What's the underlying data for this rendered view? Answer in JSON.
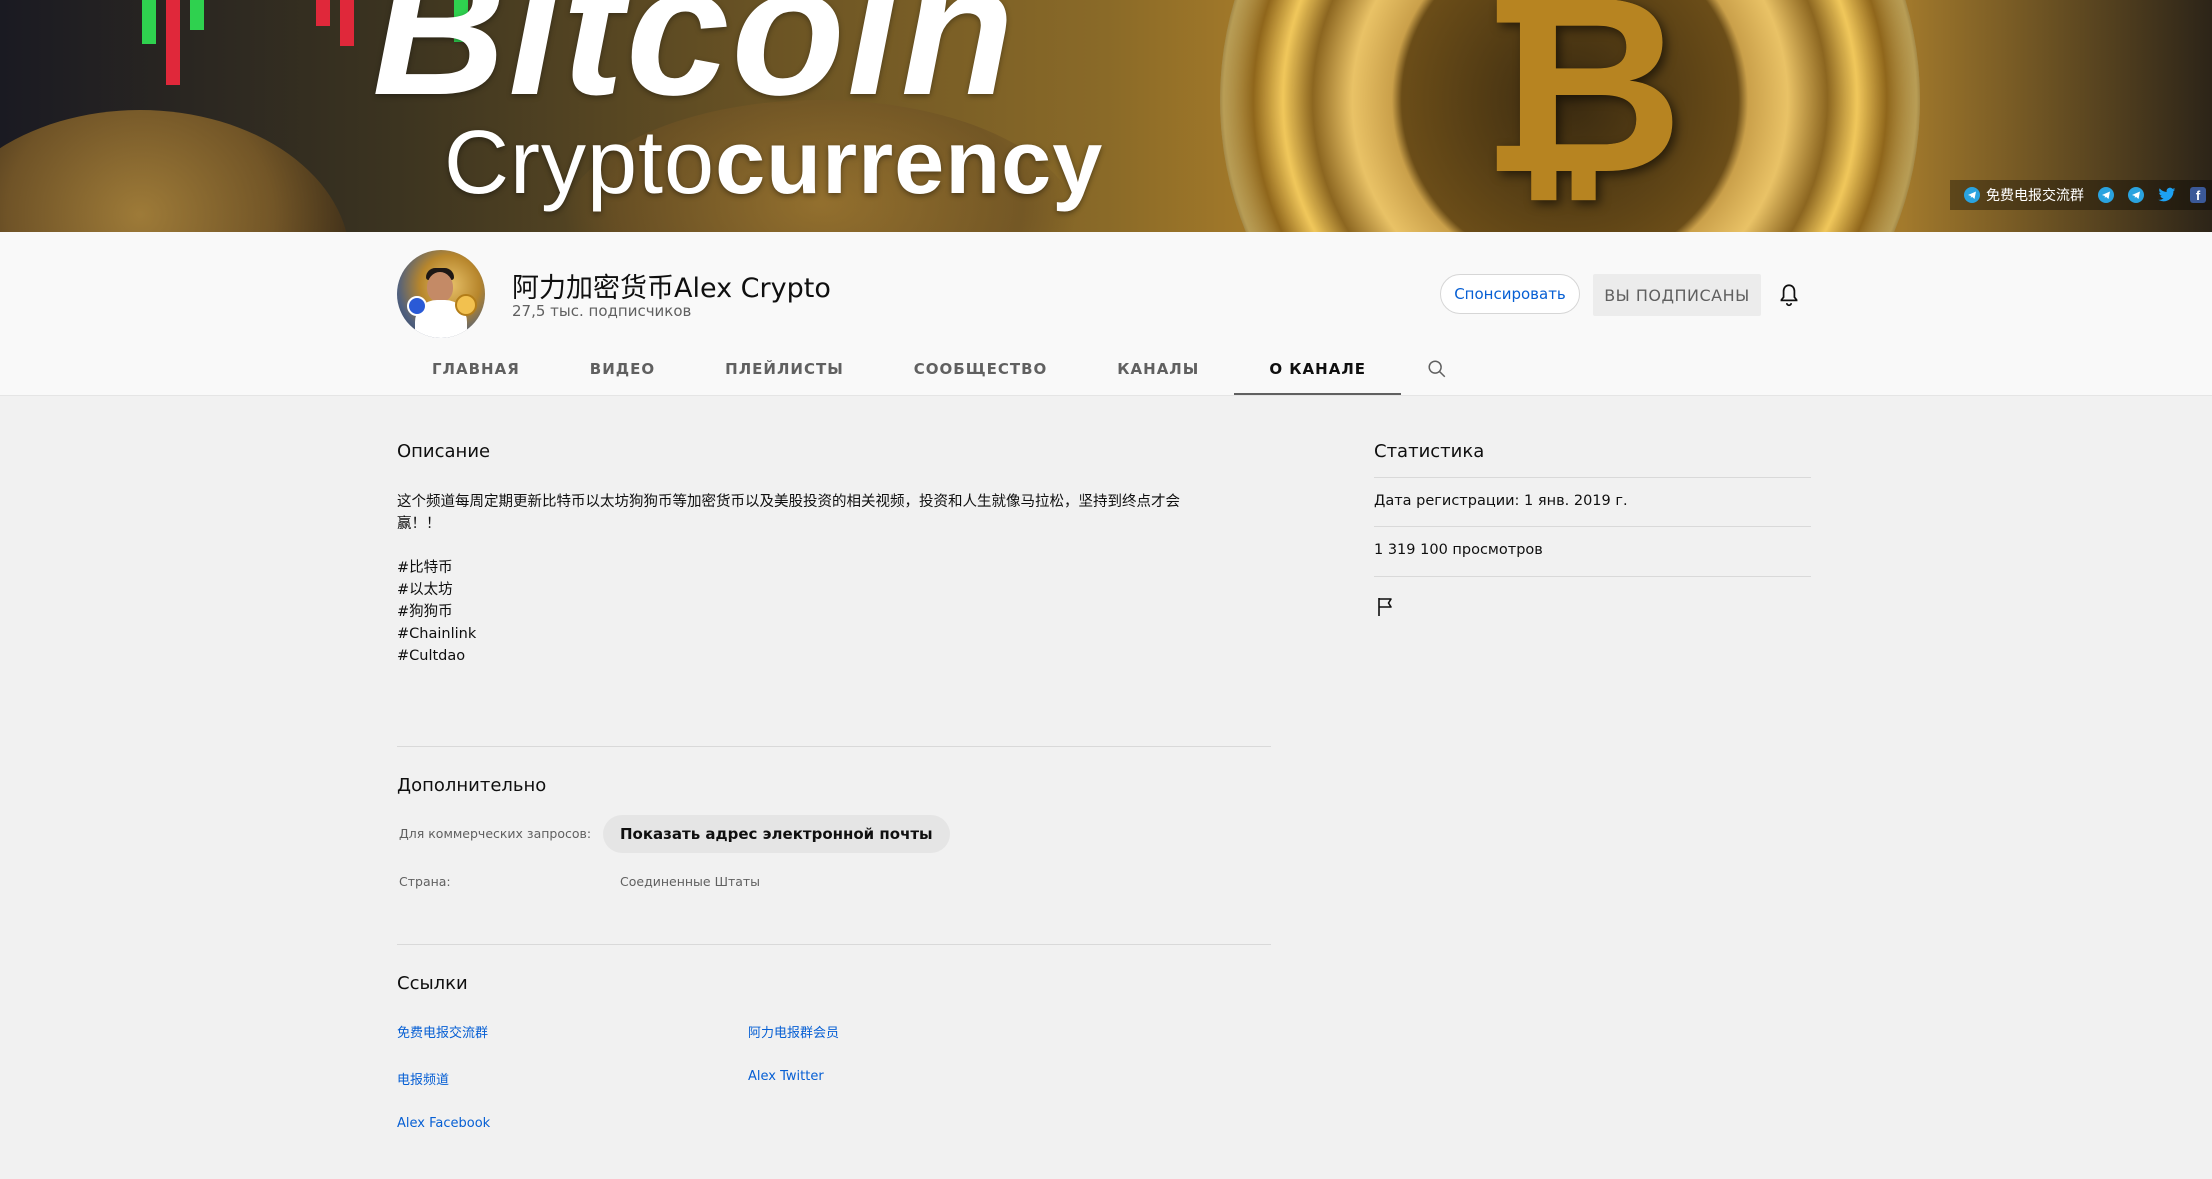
{
  "banner": {
    "title": "Bitcoin",
    "subtitle_light": "Crypto",
    "subtitle_bold": "currency",
    "links": [
      {
        "label": "免费电报交流群",
        "icon": "telegram-icon"
      },
      {
        "label": "",
        "icon": "telegram-icon"
      },
      {
        "label": "",
        "icon": "telegram-icon"
      },
      {
        "label": "",
        "icon": "twitter-icon"
      },
      {
        "label": "",
        "icon": "facebook-icon"
      }
    ]
  },
  "channel": {
    "name": "阿力加密货币Alex Crypto",
    "subscribers": "27,5 тыс. подписчиков",
    "sponsor_label": "Спонсировать",
    "subscribed_label": "ВЫ ПОДПИСАНЫ"
  },
  "tabs": [
    {
      "label": "ГЛАВНАЯ"
    },
    {
      "label": "ВИДЕО"
    },
    {
      "label": "ПЛЕЙЛИСТЫ"
    },
    {
      "label": "СООБЩЕСТВО"
    },
    {
      "label": "КАНАЛЫ"
    },
    {
      "label": "О КАНАЛЕ",
      "active": true
    }
  ],
  "about": {
    "description_title": "Описание",
    "description": "这个频道每周定期更新比特币以太坊狗狗币等加密货币以及美股投资的相关视频，投资和人生就像马拉松，坚持到终点才会\n赢！！\n\n#比特币\n#以太坊\n#狗狗币\n#Chainlink\n#Cultdao",
    "more_title": "Дополнительно",
    "business_label": "Для коммерческих запросов:",
    "email_button": "Показать адрес электронной почты",
    "country_label": "Страна:",
    "country_value": "Соединенные Штаты",
    "links_title": "Ссылки",
    "links": [
      "免费电报交流群",
      "阿力电报群会员",
      "电报频道",
      "Alex Twitter",
      "Alex Facebook"
    ]
  },
  "stats": {
    "title": "Статистика",
    "joined": "Дата регистрации: 1 янв. 2019 г.",
    "views": "1 319 100 просмотров"
  },
  "colors": {
    "link": "#065fd4",
    "page_bg": "#f1f1f1",
    "header_bg": "#f9f9f9",
    "telegram": "#2aa3df",
    "twitter": "#1da1f2",
    "facebook": "#3b5998"
  }
}
